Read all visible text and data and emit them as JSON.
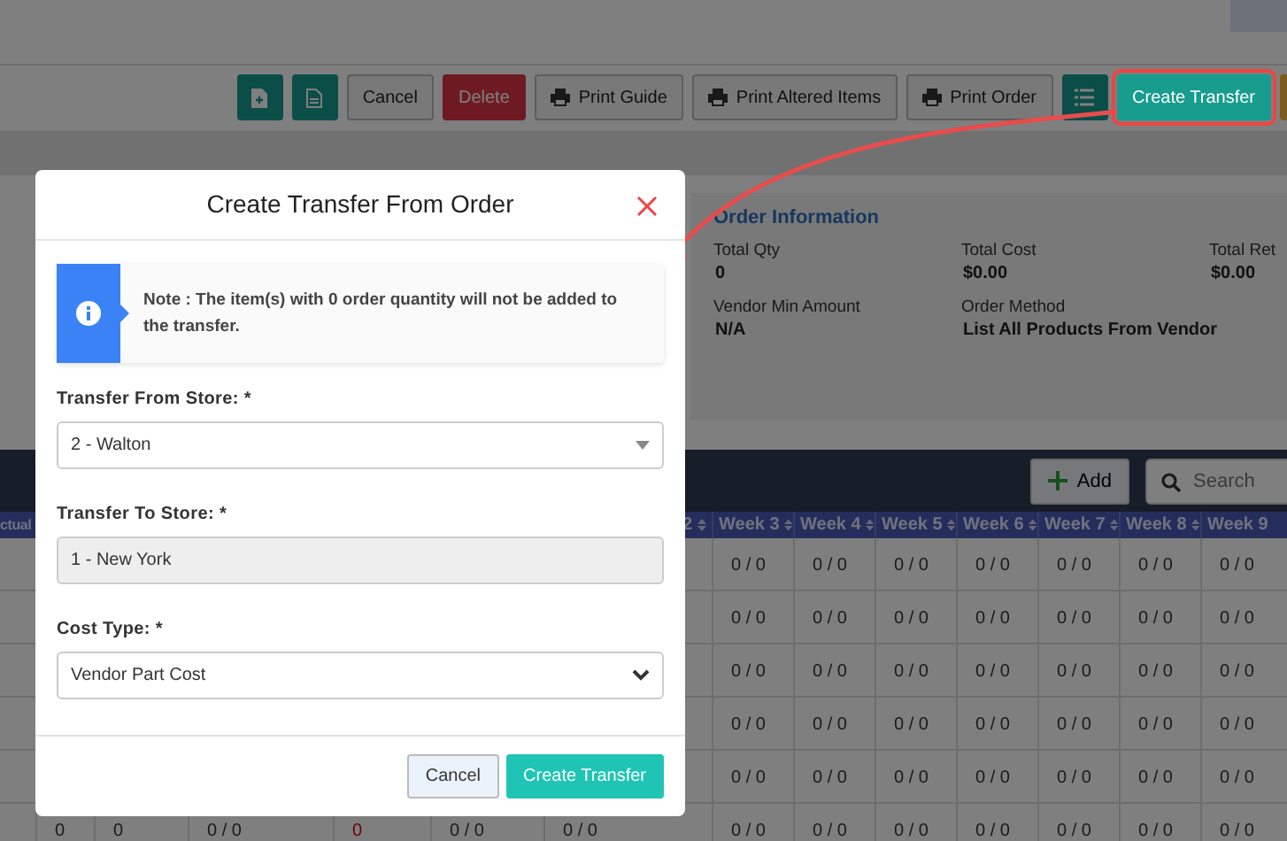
{
  "toolbar": {
    "buttons": [
      {
        "kind": "newdoc",
        "highlighted": false
      },
      {
        "kind": "doc",
        "highlighted": false
      },
      {
        "kind": "plain",
        "label": "Cancel",
        "highlighted": false
      },
      {
        "kind": "danger",
        "label": "Delete",
        "highlighted": false
      },
      {
        "kind": "print",
        "label": "Print Guide",
        "highlighted": false
      },
      {
        "kind": "print",
        "label": "Print Altered Items",
        "highlighted": false
      },
      {
        "kind": "print",
        "label": "Print Order",
        "highlighted": false
      },
      {
        "kind": "list",
        "highlighted": false
      },
      {
        "kind": "primary",
        "label": "Create Transfer",
        "highlighted": true
      },
      {
        "kind": "warning",
        "highlighted": false
      }
    ]
  },
  "order_info": {
    "title": "Order Information",
    "fields": [
      {
        "label": "Total Qty",
        "value": "0"
      },
      {
        "label": "Total Cost",
        "value": "$0.00"
      },
      {
        "label": "Total Ret",
        "value": "$0.00"
      },
      {
        "label": "Vendor Min Amount",
        "value": "N/A"
      },
      {
        "label": "Order Method",
        "value": "List All Products From Vendor"
      }
    ]
  },
  "table_toolbar": {
    "add_button": "Add",
    "search": {
      "placeholder": "Search"
    }
  },
  "table": {
    "partial_headers": [
      {
        "label": "ctual"
      },
      {
        "label": "2",
        "sortable": true
      }
    ],
    "columns": [
      {
        "label": "Week 3",
        "sortable": true
      },
      {
        "label": "Week 4",
        "sortable": true
      },
      {
        "label": "Week 5",
        "sortable": true
      },
      {
        "label": "Week 6",
        "sortable": true
      },
      {
        "label": "Week 7",
        "sortable": true
      },
      {
        "label": "Week 8",
        "sortable": true
      },
      {
        "label": "Week 9",
        "sortable": false
      }
    ],
    "rows": [
      {
        "cells": [
          {
            "text": "0 / 0",
            "alert": false
          },
          {
            "text": "0 / 0",
            "alert": false
          },
          {
            "text": "0 / 0",
            "alert": false
          },
          {
            "text": "0 / 0",
            "alert": false
          },
          {
            "text": "0 / 0",
            "alert": false
          },
          {
            "text": "0 / 0",
            "alert": false
          },
          {
            "text": "0 / 0",
            "alert": false
          }
        ]
      },
      {
        "cells": [
          {
            "text": "0 / 0",
            "alert": false
          },
          {
            "text": "0 / 0",
            "alert": false
          },
          {
            "text": "0 / 0",
            "alert": false
          },
          {
            "text": "0 / 0",
            "alert": false
          },
          {
            "text": "0 / 0",
            "alert": false
          },
          {
            "text": "0 / 0",
            "alert": false
          },
          {
            "text": "0 / 0",
            "alert": false
          }
        ]
      },
      {
        "cells": [
          {
            "text": "0 / 0",
            "alert": false
          },
          {
            "text": "0 / 0",
            "alert": false
          },
          {
            "text": "0 / 0",
            "alert": false
          },
          {
            "text": "0 / 0",
            "alert": false
          },
          {
            "text": "0 / 0",
            "alert": false
          },
          {
            "text": "0 / 0",
            "alert": false
          },
          {
            "text": "0 / 0",
            "alert": false
          }
        ]
      },
      {
        "cells": [
          {
            "text": "0 / 0",
            "alert": false
          },
          {
            "text": "0 / 0",
            "alert": false
          },
          {
            "text": "0 / 0",
            "alert": false
          },
          {
            "text": "0 / 0",
            "alert": false
          },
          {
            "text": "0 / 0",
            "alert": false
          },
          {
            "text": "0 / 0",
            "alert": false
          },
          {
            "text": "0 / 0",
            "alert": false
          }
        ]
      },
      {
        "cells": [
          {
            "text": "0 / 0",
            "alert": false
          },
          {
            "text": "0 / 0",
            "alert": false
          },
          {
            "text": "0 / 0",
            "alert": false
          },
          {
            "text": "0 / 0",
            "alert": false
          },
          {
            "text": "0 / 0",
            "alert": false
          },
          {
            "text": "0 / 0",
            "alert": false
          },
          {
            "text": "0 / 0",
            "alert": false
          }
        ]
      },
      {
        "partial_cells": [
          {
            "text": "0",
            "alert": false
          },
          {
            "text": "0",
            "alert": false
          },
          {
            "text": "0 / 0",
            "alert": false
          },
          {
            "text": "0",
            "alert": true
          },
          {
            "text": "0 / 0",
            "alert": false
          },
          {
            "text": "0 / 0",
            "alert": false
          }
        ],
        "cells": [
          {
            "text": "0 / 0",
            "alert": false
          },
          {
            "text": "0 / 0",
            "alert": false
          },
          {
            "text": "0 / 0",
            "alert": false
          },
          {
            "text": "0 / 0",
            "alert": false
          },
          {
            "text": "0 / 0",
            "alert": false
          },
          {
            "text": "0 / 0",
            "alert": false
          },
          {
            "text": "0 / 0",
            "alert": false
          }
        ]
      }
    ]
  },
  "modal": {
    "title": "Create Transfer From Order",
    "note": "Note : The item(s) with 0 order quantity will not be added to the transfer.",
    "fields": [
      {
        "kind": "combo",
        "label": "Transfer From Store: *",
        "value": "2 - Walton",
        "disabled": false
      },
      {
        "kind": "text",
        "label": "Transfer To Store: *",
        "value": "1 - New York",
        "disabled": true
      },
      {
        "kind": "select",
        "label": "Cost Type: *",
        "value": "Vendor Part Cost",
        "disabled": false
      }
    ],
    "buttons": [
      {
        "kind": "secondary",
        "label": "Cancel"
      },
      {
        "kind": "primary",
        "label": "Create Transfer"
      }
    ]
  }
}
